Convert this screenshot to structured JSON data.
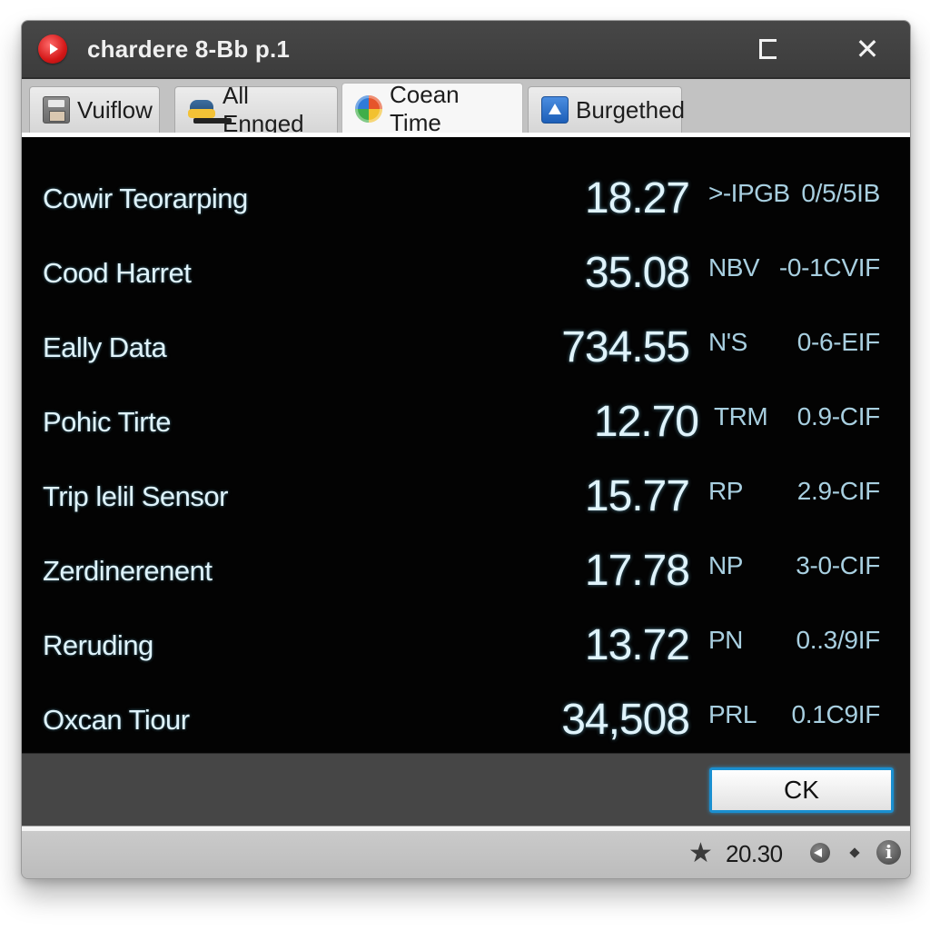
{
  "window": {
    "title": "chardere 8-Bb p.1",
    "controls": {
      "maximize": "maximize",
      "close": "✕"
    }
  },
  "tabs": [
    {
      "label": "Vuiflow",
      "icon": "floppy-disk-icon",
      "active": false
    },
    {
      "label": "All Ennged",
      "icon": "car-icon",
      "active": false
    },
    {
      "label": "Coean Time",
      "icon": "globe-icon",
      "active": true
    },
    {
      "label": "Burgethed",
      "icon": "blue-triangle-icon",
      "active": false
    }
  ],
  "rows": [
    {
      "label": "Cowir Teorarping",
      "value": "18.27",
      "unit": ">-IPGB",
      "code": "0/5/5IB"
    },
    {
      "label": "Cood Harret",
      "value": "35.08",
      "unit": "NBV",
      "code": "-0-1CVIF"
    },
    {
      "label": "Eally Data",
      "value": "734.55",
      "unit": "N'S",
      "code": "0-6-EIF"
    },
    {
      "label": "Pohic Tirte",
      "value": "12.70",
      "unit": "TRM",
      "code": "0.9-CIF"
    },
    {
      "label": "Trip lelil Sensor",
      "value": "15.77",
      "unit": "RP",
      "code": "2.9-CIF"
    },
    {
      "label": "Zerdinerenent",
      "value": "17.78",
      "unit": "NP",
      "code": "3-0-CIF"
    },
    {
      "label": "Reruding",
      "value": "13.72",
      "unit": "PN",
      "code": "0..3/9IF"
    },
    {
      "label": "Oxcan Tiour",
      "value": "34,508",
      "unit": "PRL",
      "code": "0.1C9IF"
    }
  ],
  "buttons": {
    "ok": "CK"
  },
  "statusbar": {
    "star": "★",
    "value": "20.30",
    "info": "i"
  },
  "colors": {
    "panel_bg": "#030303",
    "value_text": "#dff3fb",
    "secondary_text": "#a8cfe0",
    "ok_border": "#1a8fd0",
    "titlebar_bg": "#424242"
  }
}
